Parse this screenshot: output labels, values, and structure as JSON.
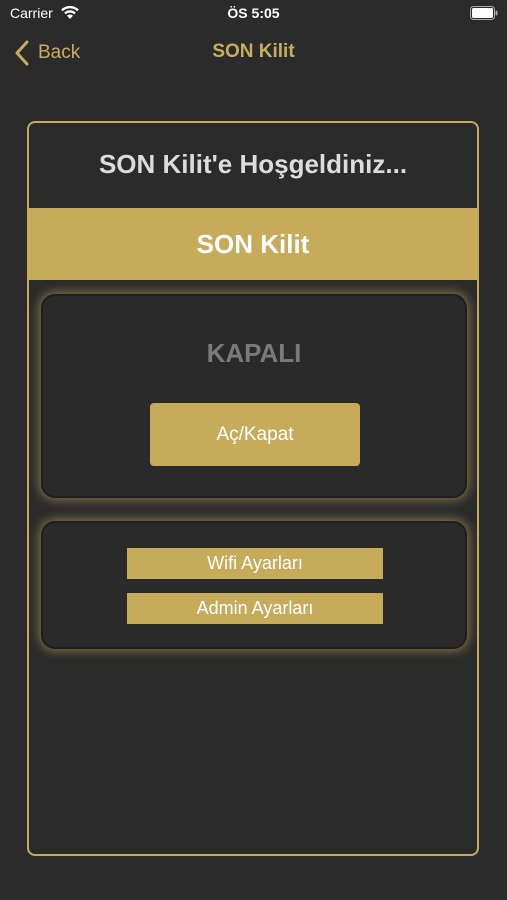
{
  "status_bar": {
    "carrier": "Carrier",
    "time": "ÖS 5:05",
    "icons": [
      "wifi-icon",
      "battery-icon"
    ]
  },
  "nav": {
    "back_label": "Back",
    "title": "SON Kilit"
  },
  "main": {
    "welcome": "SON Kilit'e Hoşgeldiniz...",
    "banner_title": "SON Kilit",
    "lock_status": "KAPALI",
    "toggle_label": "Aç/Kapat",
    "wifi_settings_label": "Wifi Ayarları",
    "admin_settings_label": "Admin Ayarları"
  },
  "colors": {
    "background": "#2b2b2b",
    "accent_gold": "#c6ab5b",
    "status_text_gray": "#7a7a7a",
    "welcome_text": "#dcdcdc"
  }
}
